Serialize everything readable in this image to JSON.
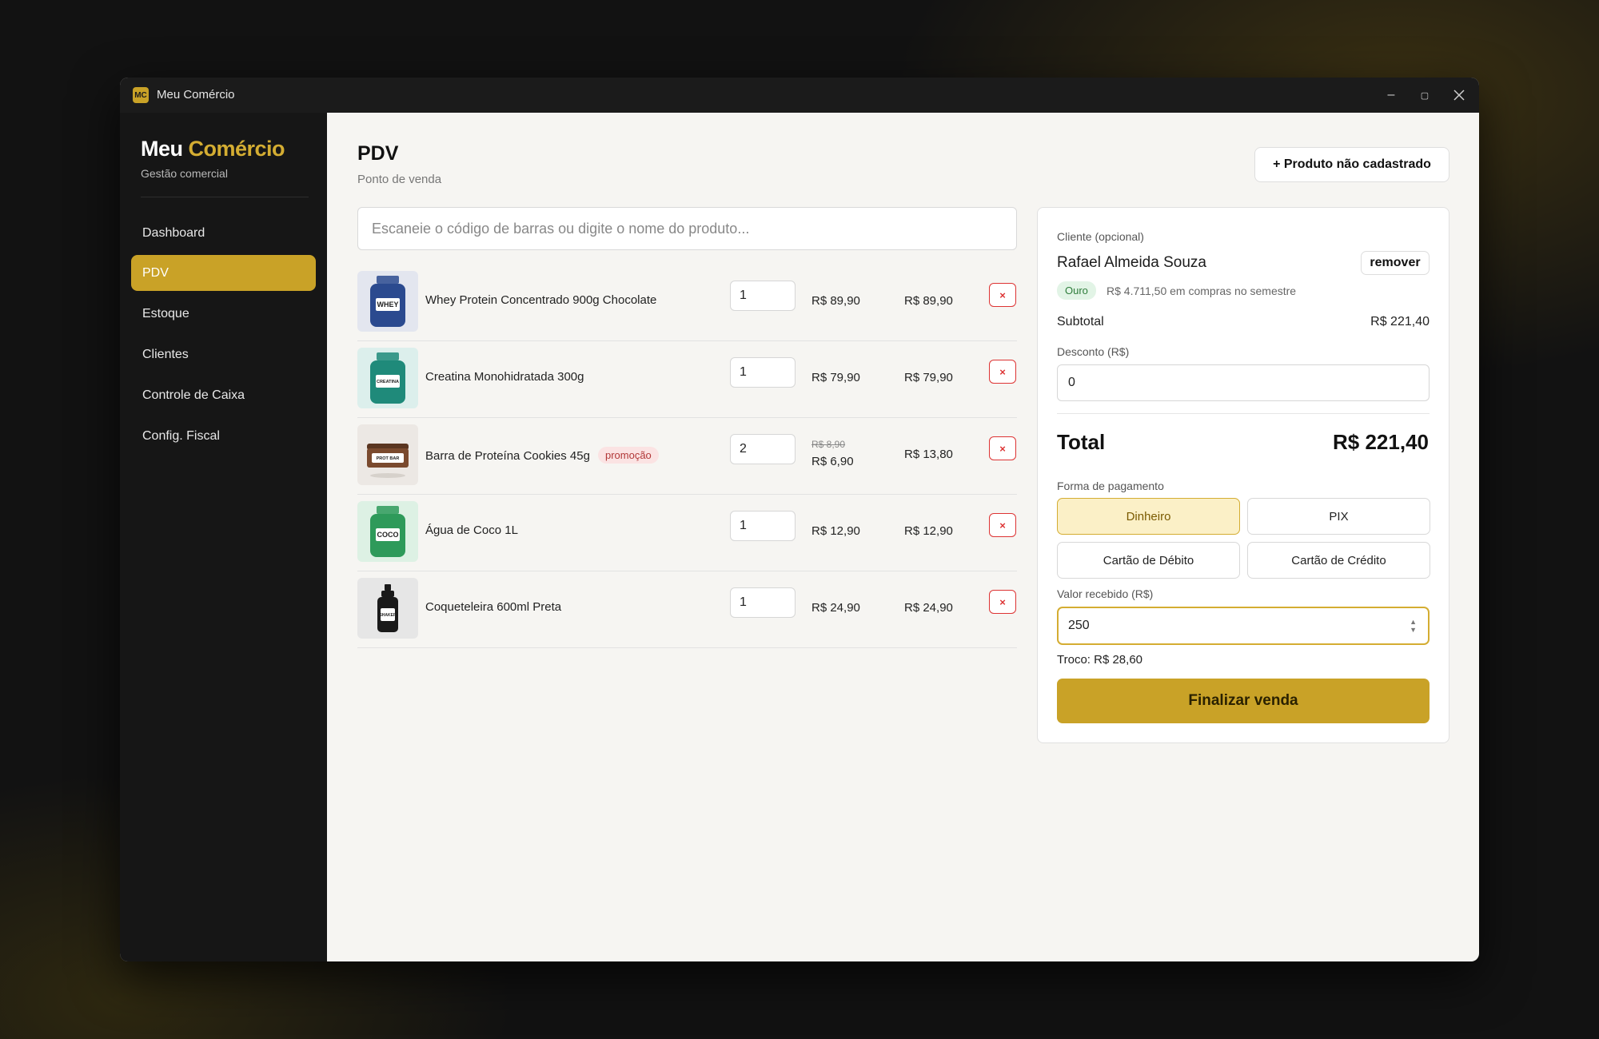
{
  "window": {
    "title": "Meu Comércio",
    "app_icon_text": "MC"
  },
  "sidebar": {
    "brand_first": "Meu",
    "brand_accent": "Comércio",
    "subtitle": "Gestão comercial",
    "items": [
      {
        "label": "Dashboard",
        "active": false
      },
      {
        "label": "PDV",
        "active": true
      },
      {
        "label": "Estoque",
        "active": false
      },
      {
        "label": "Clientes",
        "active": false
      },
      {
        "label": "Controle de Caixa",
        "active": false
      },
      {
        "label": "Config. Fiscal",
        "active": false
      }
    ]
  },
  "page": {
    "title": "PDV",
    "subtitle": "Ponto de venda",
    "unregistered_button": "+ Produto não cadastrado",
    "search_placeholder": "Escaneie o código de barras ou digite o nome do produto..."
  },
  "cart": [
    {
      "name": "Whey Protein Concentrado 900g Chocolate",
      "badge": "",
      "qty": "1",
      "unit_price": "R$ 89,90",
      "old_price": "",
      "total": "R$ 89,90",
      "thumb_label": "WHEY",
      "thumb_color": "#2b4a8f",
      "thumb_bg": "#e3e6ef",
      "icon": "whey-jar-icon"
    },
    {
      "name": "Creatina Monohidratada 300g",
      "badge": "",
      "qty": "1",
      "unit_price": "R$ 79,90",
      "old_price": "",
      "total": "R$ 79,90",
      "thumb_label": "CREATINA",
      "thumb_color": "#1f8a7a",
      "thumb_bg": "#dcefec",
      "icon": "creatine-jar-icon"
    },
    {
      "name": "Barra de Proteína Cookies 45g",
      "badge": "promoção",
      "qty": "2",
      "unit_price": "R$ 6,90",
      "old_price": "R$ 8,90",
      "total": "R$ 13,80",
      "thumb_label": "PROT BAR",
      "thumb_color": "#7a4a2e",
      "thumb_bg": "#ece8e4",
      "icon": "protein-bar-icon"
    },
    {
      "name": "Água de Coco 1L",
      "badge": "",
      "qty": "1",
      "unit_price": "R$ 12,90",
      "old_price": "",
      "total": "R$ 12,90",
      "thumb_label": "COCO",
      "thumb_color": "#2e9a5a",
      "thumb_bg": "#ddf1e4",
      "icon": "coconut-water-icon"
    },
    {
      "name": "Coqueteleira 600ml Preta",
      "badge": "",
      "qty": "1",
      "unit_price": "R$ 24,90",
      "old_price": "",
      "total": "R$ 24,90",
      "thumb_label": "SHAKER",
      "thumb_color": "#1a1a1a",
      "thumb_bg": "#e6e6e6",
      "icon": "shaker-bottle-icon"
    }
  ],
  "remove_symbol": "×",
  "panel": {
    "customer_label": "Cliente (opcional)",
    "customer_name": "Rafael Almeida Souza",
    "remove_button": "remover",
    "tier": "Ouro",
    "tier_note": "R$ 4.711,50 em compras no semestre",
    "subtotal_label": "Subtotal",
    "subtotal_value": "R$ 221,40",
    "discount_label": "Desconto (R$)",
    "discount_value": "0",
    "total_label": "Total",
    "total_value": "R$ 221,40",
    "payment_label": "Forma de pagamento",
    "payment_options": [
      {
        "label": "Dinheiro",
        "selected": true
      },
      {
        "label": "PIX",
        "selected": false
      },
      {
        "label": "Cartão de Débito",
        "selected": false
      },
      {
        "label": "Cartão de Crédito",
        "selected": false
      }
    ],
    "received_label": "Valor recebido (R$)",
    "received_value": "250",
    "change_text": "Troco: R$ 28,60",
    "finalize_button": "Finalizar venda"
  },
  "colors": {
    "accent": "#c9a227",
    "sidebar_bg": "#161616",
    "danger": "#d33333",
    "tier_green": "#2e7d3b"
  }
}
